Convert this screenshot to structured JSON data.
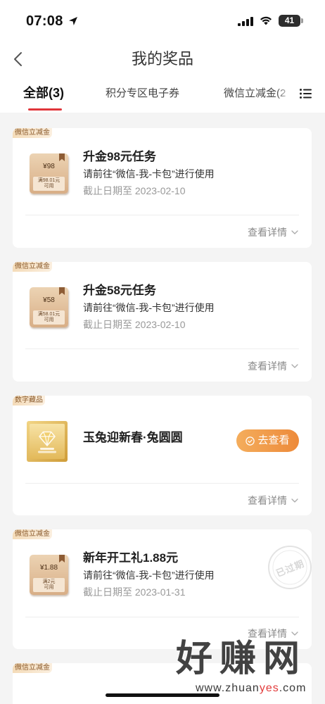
{
  "status_bar": {
    "time": "07:08",
    "battery": "41",
    "icons": {
      "location": "location-arrow-icon",
      "signal": "cellular-signal-icon",
      "wifi": "wifi-icon",
      "battery": "battery-icon"
    }
  },
  "header": {
    "title": "我的奖品",
    "back_icon": "chevron-left-icon"
  },
  "tabs": {
    "items": [
      {
        "label": "全部(3)",
        "active": true
      },
      {
        "label": "积分专区电子券",
        "active": false
      },
      {
        "label": "微信立减金(2",
        "active": false
      }
    ],
    "menu_icon": "list-icon"
  },
  "cards": [
    {
      "badge": "微信立减金",
      "coupon": {
        "amount": "¥98",
        "condition": "满98.01元",
        "usable": "可用"
      },
      "title": "升金98元任务",
      "subtitle": "请前往“微信-我-卡包”进行使用",
      "deadline": "截止日期至 2023-02-10",
      "details_label": "查看详情",
      "details_icon": "chevron-down-icon"
    },
    {
      "badge": "微信立减金",
      "coupon": {
        "amount": "¥58",
        "condition": "满58.01元",
        "usable": "可用"
      },
      "title": "升金58元任务",
      "subtitle": "请前往“微信-我-卡包”进行使用",
      "deadline": "截止日期至 2023-02-10",
      "details_label": "查看详情",
      "details_icon": "chevron-down-icon"
    },
    {
      "badge": "数字藏品",
      "thumbnail_icon": "diamond-icon",
      "title": "玉兔迎新春·兔圆圆",
      "action_label": "去查看",
      "action_icon": "check-circle-icon",
      "details_label": "查看详情",
      "details_icon": "chevron-down-icon"
    },
    {
      "badge": "微信立减金",
      "coupon": {
        "amount": "¥1.88",
        "condition": "满2元",
        "usable": "可用"
      },
      "title": "新年开工礼1.88元",
      "subtitle": "请前往“微信-我-卡包”进行使用",
      "deadline": "截止日期至 2023-01-31",
      "stamp": "已过期",
      "details_label": "查看详情",
      "details_icon": "chevron-down-icon"
    },
    {
      "badge": "微信立减金"
    }
  ],
  "watermark": {
    "brand": "好赚网",
    "url_prefix": "www.zhuan",
    "url_accent": "yes",
    "url_suffix": ".com"
  },
  "colors": {
    "page_background": "#f4f4f4",
    "tab_underline": "#e0353b",
    "badge_text": "#8a5a2c",
    "action_button": "#f09444",
    "watermark_accent": "#e23b3b"
  }
}
